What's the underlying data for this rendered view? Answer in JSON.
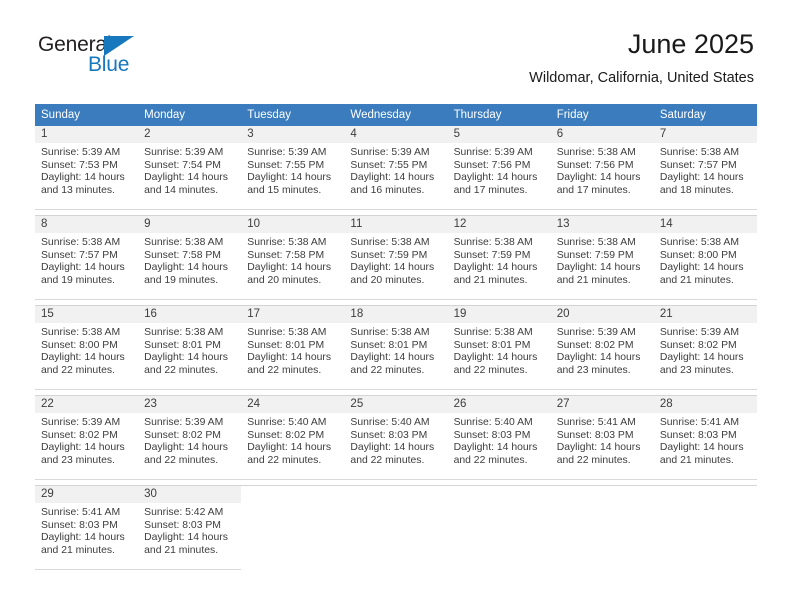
{
  "brand": {
    "name_part1": "General",
    "name_part2": "Blue",
    "color_primary": "#1878be",
    "logo_icon": "triangle-icon"
  },
  "header": {
    "title": "June 2025",
    "subtitle": "Wildomar, California, United States"
  },
  "calendar": {
    "header_bg": "#3a7cbd",
    "daynum_bg": "#f1f1f1",
    "weekday_headers": [
      "Sunday",
      "Monday",
      "Tuesday",
      "Wednesday",
      "Thursday",
      "Friday",
      "Saturday"
    ],
    "weeks": [
      [
        {
          "day": "1",
          "sunrise": "Sunrise: 5:39 AM",
          "sunset": "Sunset: 7:53 PM",
          "daylight_line1": "Daylight: 14 hours",
          "daylight_line2": "and 13 minutes."
        },
        {
          "day": "2",
          "sunrise": "Sunrise: 5:39 AM",
          "sunset": "Sunset: 7:54 PM",
          "daylight_line1": "Daylight: 14 hours",
          "daylight_line2": "and 14 minutes."
        },
        {
          "day": "3",
          "sunrise": "Sunrise: 5:39 AM",
          "sunset": "Sunset: 7:55 PM",
          "daylight_line1": "Daylight: 14 hours",
          "daylight_line2": "and 15 minutes."
        },
        {
          "day": "4",
          "sunrise": "Sunrise: 5:39 AM",
          "sunset": "Sunset: 7:55 PM",
          "daylight_line1": "Daylight: 14 hours",
          "daylight_line2": "and 16 minutes."
        },
        {
          "day": "5",
          "sunrise": "Sunrise: 5:39 AM",
          "sunset": "Sunset: 7:56 PM",
          "daylight_line1": "Daylight: 14 hours",
          "daylight_line2": "and 17 minutes."
        },
        {
          "day": "6",
          "sunrise": "Sunrise: 5:38 AM",
          "sunset": "Sunset: 7:56 PM",
          "daylight_line1": "Daylight: 14 hours",
          "daylight_line2": "and 17 minutes."
        },
        {
          "day": "7",
          "sunrise": "Sunrise: 5:38 AM",
          "sunset": "Sunset: 7:57 PM",
          "daylight_line1": "Daylight: 14 hours",
          "daylight_line2": "and 18 minutes."
        }
      ],
      [
        {
          "day": "8",
          "sunrise": "Sunrise: 5:38 AM",
          "sunset": "Sunset: 7:57 PM",
          "daylight_line1": "Daylight: 14 hours",
          "daylight_line2": "and 19 minutes."
        },
        {
          "day": "9",
          "sunrise": "Sunrise: 5:38 AM",
          "sunset": "Sunset: 7:58 PM",
          "daylight_line1": "Daylight: 14 hours",
          "daylight_line2": "and 19 minutes."
        },
        {
          "day": "10",
          "sunrise": "Sunrise: 5:38 AM",
          "sunset": "Sunset: 7:58 PM",
          "daylight_line1": "Daylight: 14 hours",
          "daylight_line2": "and 20 minutes."
        },
        {
          "day": "11",
          "sunrise": "Sunrise: 5:38 AM",
          "sunset": "Sunset: 7:59 PM",
          "daylight_line1": "Daylight: 14 hours",
          "daylight_line2": "and 20 minutes."
        },
        {
          "day": "12",
          "sunrise": "Sunrise: 5:38 AM",
          "sunset": "Sunset: 7:59 PM",
          "daylight_line1": "Daylight: 14 hours",
          "daylight_line2": "and 21 minutes."
        },
        {
          "day": "13",
          "sunrise": "Sunrise: 5:38 AM",
          "sunset": "Sunset: 7:59 PM",
          "daylight_line1": "Daylight: 14 hours",
          "daylight_line2": "and 21 minutes."
        },
        {
          "day": "14",
          "sunrise": "Sunrise: 5:38 AM",
          "sunset": "Sunset: 8:00 PM",
          "daylight_line1": "Daylight: 14 hours",
          "daylight_line2": "and 21 minutes."
        }
      ],
      [
        {
          "day": "15",
          "sunrise": "Sunrise: 5:38 AM",
          "sunset": "Sunset: 8:00 PM",
          "daylight_line1": "Daylight: 14 hours",
          "daylight_line2": "and 22 minutes."
        },
        {
          "day": "16",
          "sunrise": "Sunrise: 5:38 AM",
          "sunset": "Sunset: 8:01 PM",
          "daylight_line1": "Daylight: 14 hours",
          "daylight_line2": "and 22 minutes."
        },
        {
          "day": "17",
          "sunrise": "Sunrise: 5:38 AM",
          "sunset": "Sunset: 8:01 PM",
          "daylight_line1": "Daylight: 14 hours",
          "daylight_line2": "and 22 minutes."
        },
        {
          "day": "18",
          "sunrise": "Sunrise: 5:38 AM",
          "sunset": "Sunset: 8:01 PM",
          "daylight_line1": "Daylight: 14 hours",
          "daylight_line2": "and 22 minutes."
        },
        {
          "day": "19",
          "sunrise": "Sunrise: 5:38 AM",
          "sunset": "Sunset: 8:01 PM",
          "daylight_line1": "Daylight: 14 hours",
          "daylight_line2": "and 22 minutes."
        },
        {
          "day": "20",
          "sunrise": "Sunrise: 5:39 AM",
          "sunset": "Sunset: 8:02 PM",
          "daylight_line1": "Daylight: 14 hours",
          "daylight_line2": "and 23 minutes."
        },
        {
          "day": "21",
          "sunrise": "Sunrise: 5:39 AM",
          "sunset": "Sunset: 8:02 PM",
          "daylight_line1": "Daylight: 14 hours",
          "daylight_line2": "and 23 minutes."
        }
      ],
      [
        {
          "day": "22",
          "sunrise": "Sunrise: 5:39 AM",
          "sunset": "Sunset: 8:02 PM",
          "daylight_line1": "Daylight: 14 hours",
          "daylight_line2": "and 23 minutes."
        },
        {
          "day": "23",
          "sunrise": "Sunrise: 5:39 AM",
          "sunset": "Sunset: 8:02 PM",
          "daylight_line1": "Daylight: 14 hours",
          "daylight_line2": "and 22 minutes."
        },
        {
          "day": "24",
          "sunrise": "Sunrise: 5:40 AM",
          "sunset": "Sunset: 8:02 PM",
          "daylight_line1": "Daylight: 14 hours",
          "daylight_line2": "and 22 minutes."
        },
        {
          "day": "25",
          "sunrise": "Sunrise: 5:40 AM",
          "sunset": "Sunset: 8:03 PM",
          "daylight_line1": "Daylight: 14 hours",
          "daylight_line2": "and 22 minutes."
        },
        {
          "day": "26",
          "sunrise": "Sunrise: 5:40 AM",
          "sunset": "Sunset: 8:03 PM",
          "daylight_line1": "Daylight: 14 hours",
          "daylight_line2": "and 22 minutes."
        },
        {
          "day": "27",
          "sunrise": "Sunrise: 5:41 AM",
          "sunset": "Sunset: 8:03 PM",
          "daylight_line1": "Daylight: 14 hours",
          "daylight_line2": "and 22 minutes."
        },
        {
          "day": "28",
          "sunrise": "Sunrise: 5:41 AM",
          "sunset": "Sunset: 8:03 PM",
          "daylight_line1": "Daylight: 14 hours",
          "daylight_line2": "and 21 minutes."
        }
      ],
      [
        {
          "day": "29",
          "sunrise": "Sunrise: 5:41 AM",
          "sunset": "Sunset: 8:03 PM",
          "daylight_line1": "Daylight: 14 hours",
          "daylight_line2": "and 21 minutes."
        },
        {
          "day": "30",
          "sunrise": "Sunrise: 5:42 AM",
          "sunset": "Sunset: 8:03 PM",
          "daylight_line1": "Daylight: 14 hours",
          "daylight_line2": "and 21 minutes."
        },
        null,
        null,
        null,
        null,
        null
      ]
    ]
  }
}
